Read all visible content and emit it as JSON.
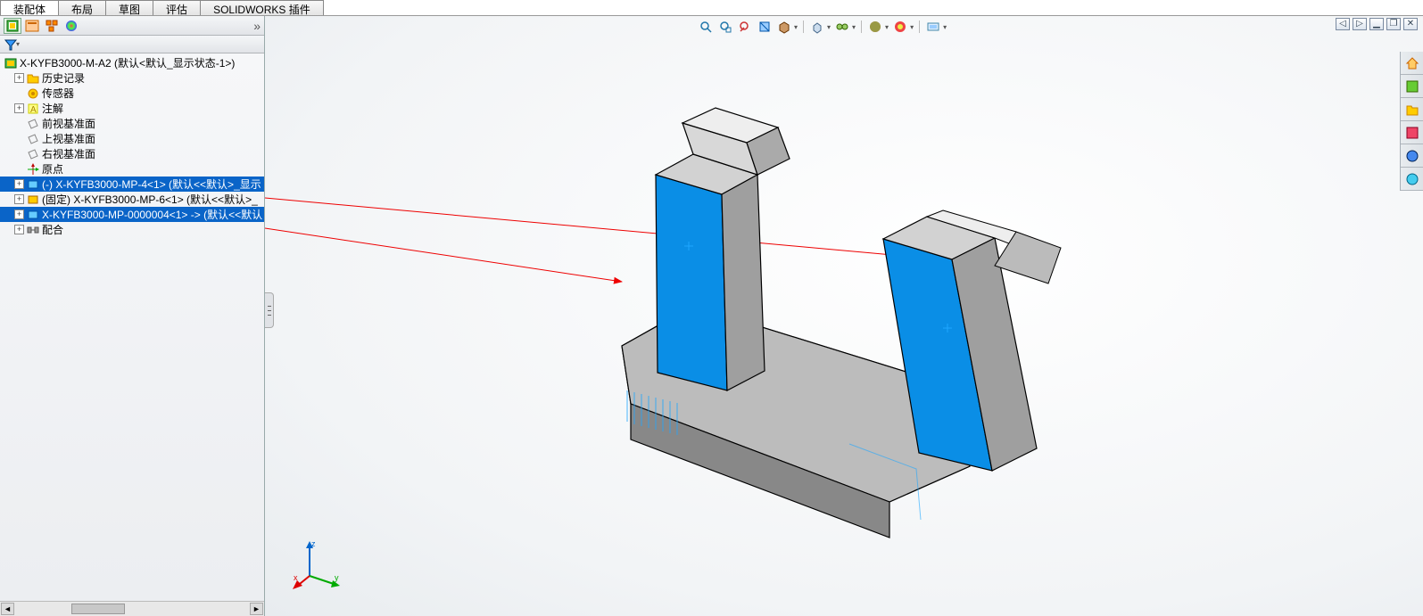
{
  "tabs": {
    "items": [
      "装配体",
      "布局",
      "草图",
      "评估",
      "SOLIDWORKS 插件"
    ],
    "active": 0
  },
  "panel_tabs": [
    "assembly",
    "property",
    "config",
    "appearance"
  ],
  "tree": {
    "root": "X-KYFB3000-M-A2  (默认<默认_显示状态-1>)",
    "history": "历史记录",
    "sensors": "传感器",
    "annotations": "注解",
    "plane_front": "前视基准面",
    "plane_top": "上视基准面",
    "plane_right": "右视基准面",
    "origin": "原点",
    "part1": "(-) X-KYFB3000-MP-4<1> (默认<<默认>_显示",
    "part2": "(固定) X-KYFB3000-MP-6<1> (默认<<默认>_",
    "part3": "X-KYFB3000-MP-0000004<1> -> (默认<<默认",
    "mates": "配合"
  },
  "hud_icons": [
    "zoom-fit",
    "zoom-area",
    "zoom-prev",
    "section",
    "display-style",
    "box",
    "hide-show",
    "link",
    "appearance",
    "scene",
    "render"
  ],
  "win_controls": [
    "expand",
    "detach",
    "minimize",
    "maximize",
    "close"
  ],
  "taskpane_icons": [
    "home",
    "resources",
    "library",
    "appearances",
    "properties",
    "forum"
  ],
  "triad_labels": {
    "x": "x",
    "y": "y",
    "z": "z"
  }
}
